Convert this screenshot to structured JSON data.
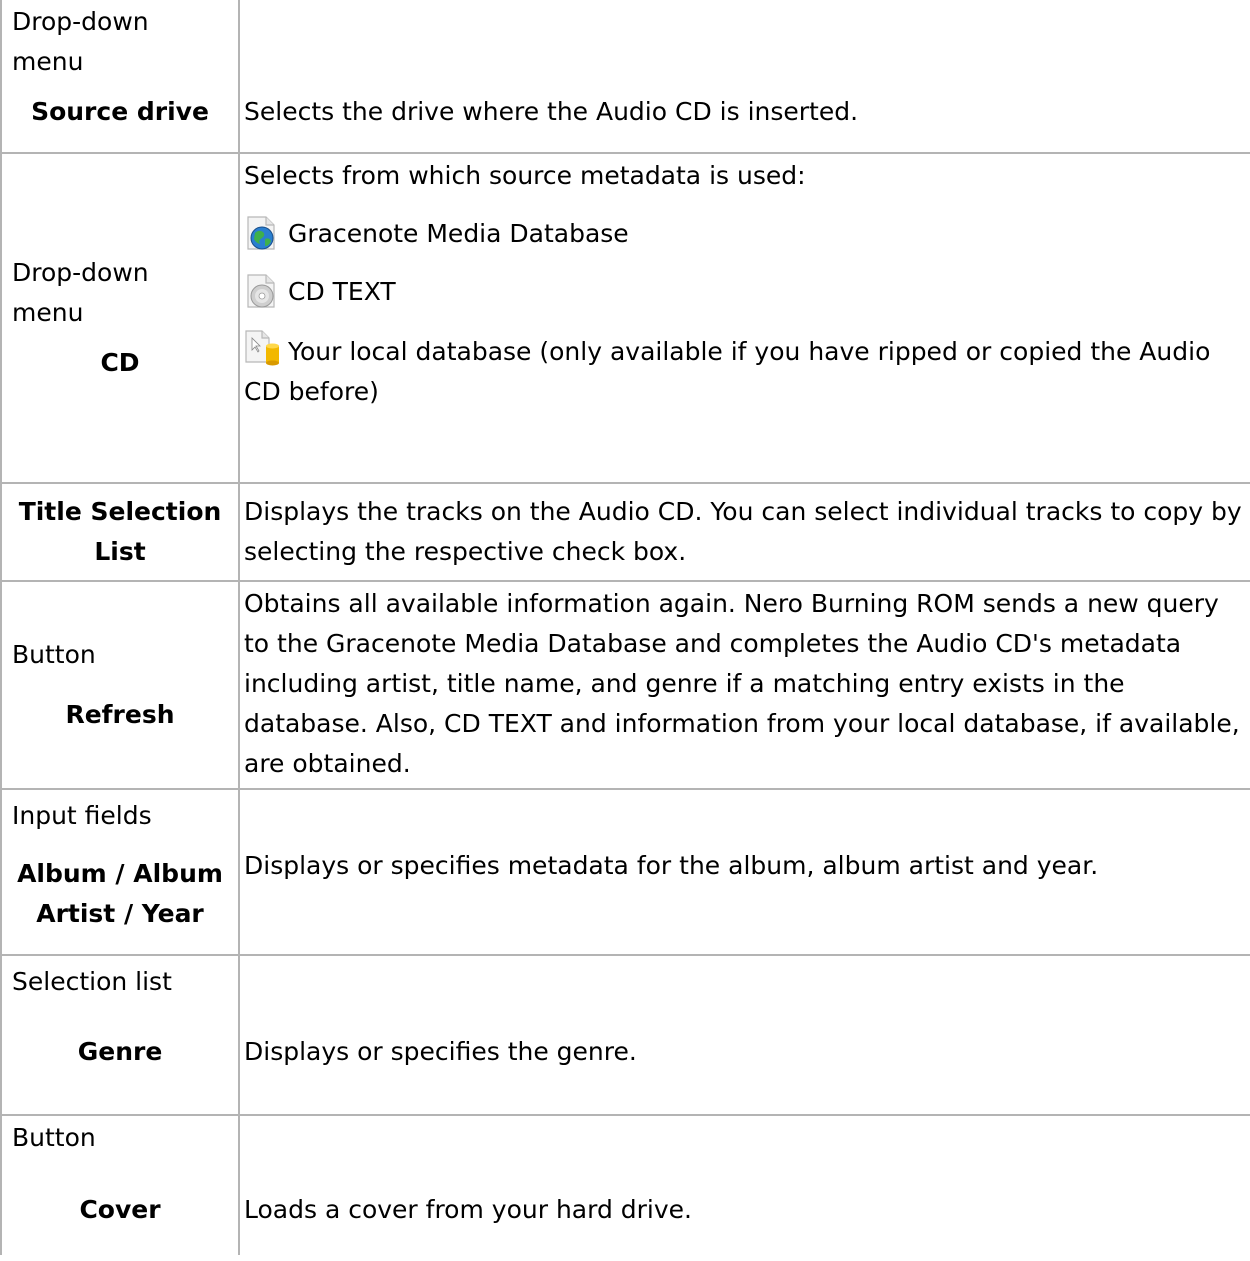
{
  "rows": [
    {
      "kind": "Drop-down menu",
      "name": "Source drive",
      "desc": "Selects the drive where the Audio CD is inserted."
    },
    {
      "kind": "Drop-down menu",
      "name": "CD",
      "desc": "Selects from which source metadata is used:",
      "options": [
        {
          "icon": "globe-database-icon",
          "label": "Gracenote Media Database"
        },
        {
          "icon": "cd-text-icon",
          "label": "CD TEXT"
        },
        {
          "icon": "local-database-icon",
          "label": "Your local database (only available if you have ripped or copied the Audio CD before)"
        }
      ]
    },
    {
      "kind": "",
      "name": "Title Selection List",
      "desc": "Displays the tracks on the Audio CD. You can select individual tracks to copy by selecting the respective check box."
    },
    {
      "kind": "Button",
      "name": "Refresh",
      "desc": "Obtains all available information again. Nero Burning ROM sends a new query to the Gracenote Media Database and completes the Audio CD's metadata including artist, title name, and genre if a matching entry exists in the database. Also, CD TEXT and information from your local database, if available, are obtained."
    },
    {
      "kind": "Input fields",
      "name": "Album / Album Artist / Year",
      "desc": "Displays or specifies metadata for the album, album artist and year."
    },
    {
      "kind": "Selection list",
      "name": "Genre",
      "desc": "Displays or specifies the genre."
    },
    {
      "kind": "Button",
      "name": "Cover",
      "desc": "Loads a cover from your hard drive."
    }
  ]
}
